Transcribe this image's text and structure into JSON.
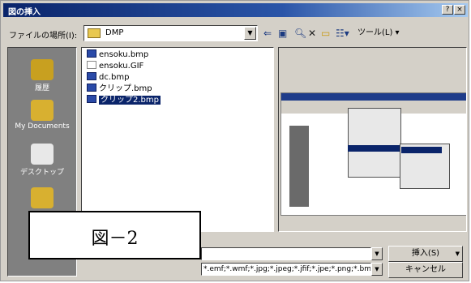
{
  "window": {
    "title": "図の挿入",
    "help_btn": "?",
    "close_btn": "×"
  },
  "toolbar": {
    "look_in_label": "ファイルの場所(I):",
    "look_in_value": "DMP",
    "tools_label": "ツール(L) ▾"
  },
  "places": [
    {
      "label": "履歴",
      "icon": "history-icon"
    },
    {
      "label": "My Documents",
      "icon": "my-documents-icon"
    },
    {
      "label": "デスクトップ",
      "icon": "desktop-icon"
    },
    {
      "label": "",
      "icon": "favorites-icon"
    }
  ],
  "files": [
    {
      "name": "ensoku.bmp",
      "selected": false
    },
    {
      "name": "ensoku.GIF",
      "selected": false
    },
    {
      "name": "dc.bmp",
      "selected": false
    },
    {
      "name": "クリップ.bmp",
      "selected": false
    },
    {
      "name": "クリップ2.bmp",
      "selected": true
    }
  ],
  "caption": "図－2",
  "file_type_value": "*.emf;*.wmf;*.jpg;*.jpeg;*.jfif;*.jpe;*.png;*.bmp",
  "buttons": {
    "insert": "挿入(S)",
    "cancel": "キャンセル"
  }
}
